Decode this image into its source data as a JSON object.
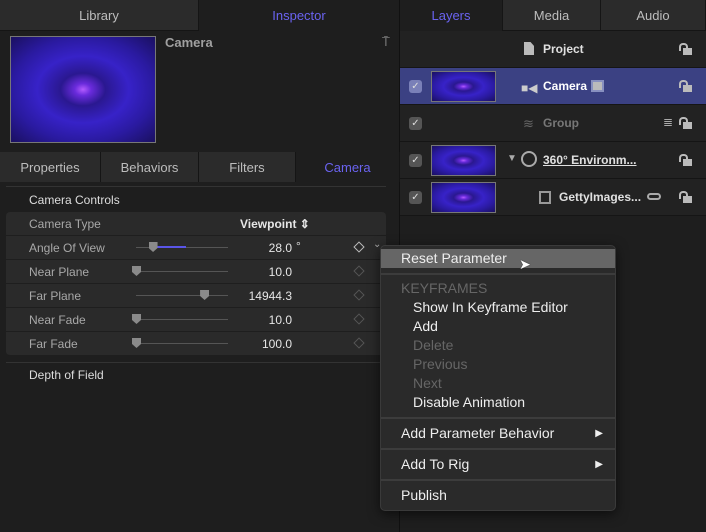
{
  "left_tabs": [
    "Library",
    "Inspector"
  ],
  "right_tabs": [
    "Layers",
    "Media",
    "Audio"
  ],
  "inspector": {
    "title": "Camera",
    "subtabs": [
      "Properties",
      "Behaviors",
      "Filters",
      "Camera"
    ],
    "section": "Camera Controls",
    "camera_type": {
      "label": "Camera Type",
      "value": "Viewpoint"
    },
    "params": [
      {
        "label": "Angle Of View",
        "value": "28.0",
        "unit": "°",
        "slider": 0.18
      },
      {
        "label": "Near Plane",
        "value": "10.0",
        "unit": "",
        "slider": 0.0
      },
      {
        "label": "Far Plane",
        "value": "14944.3",
        "unit": "",
        "slider": 0.74
      },
      {
        "label": "Near Fade",
        "value": "10.0",
        "unit": "",
        "slider": 0.0
      },
      {
        "label": "Far Fade",
        "value": "100.0",
        "unit": "",
        "slider": 0.0
      }
    ],
    "depth_of_field": "Depth of Field"
  },
  "layers": [
    {
      "name": "Project"
    },
    {
      "name": "Camera",
      "selected": true
    },
    {
      "name": "Group"
    },
    {
      "name": "360° Environm..."
    },
    {
      "name": "GettyImages..."
    }
  ],
  "menu": {
    "reset": "Reset Parameter",
    "keyframes_header": "KEYFRAMES",
    "keyframe_items": [
      "Show In Keyframe Editor",
      "Add",
      "Delete",
      "Previous",
      "Next",
      "Disable Animation"
    ],
    "add_behavior": "Add Parameter Behavior",
    "add_rig": "Add To Rig",
    "publish": "Publish"
  },
  "colors": {
    "accent": "#6a63f0",
    "selected_row": "#3b4183"
  }
}
